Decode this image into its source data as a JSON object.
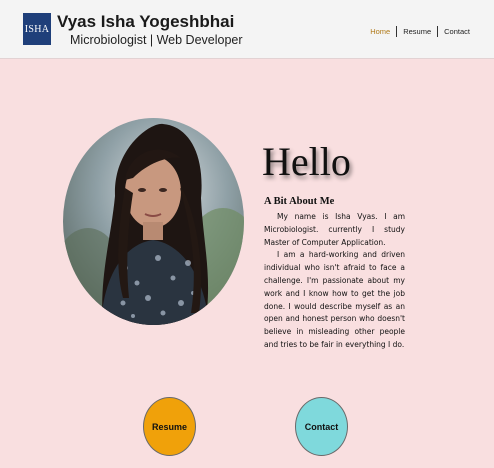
{
  "header": {
    "logo_text": "ISHA",
    "title": "Vyas Isha Yogeshbhai",
    "subtitle": "Microbiologist | Web Developer",
    "nav": {
      "home": "Home",
      "resume": "Resume",
      "contact": "Contact"
    },
    "active_nav": "Home"
  },
  "main": {
    "greeting": "Hello",
    "about_heading": "A Bit About Me",
    "about_paragraphs": [
      "My name is Isha Vyas. I am Microbiologist. currently I study Master of Computer Application.",
      "I am a hard-working and driven individual who isn't afraid to face a challenge. I'm passionate about my work and I know how to get the job done. I would describe myself as an open and honest person who doesn't believe in misleading other people and tries to be fair in everything I do."
    ]
  },
  "buttons": {
    "resume": "Resume",
    "contact": "Contact"
  },
  "colors": {
    "background": "#f9dfe0",
    "header": "#f4f4f4",
    "logo": "#1f3f7a",
    "resume_button": "#f0a10a",
    "contact_button": "#7fd9dc",
    "active_nav": "#b07a1a"
  }
}
